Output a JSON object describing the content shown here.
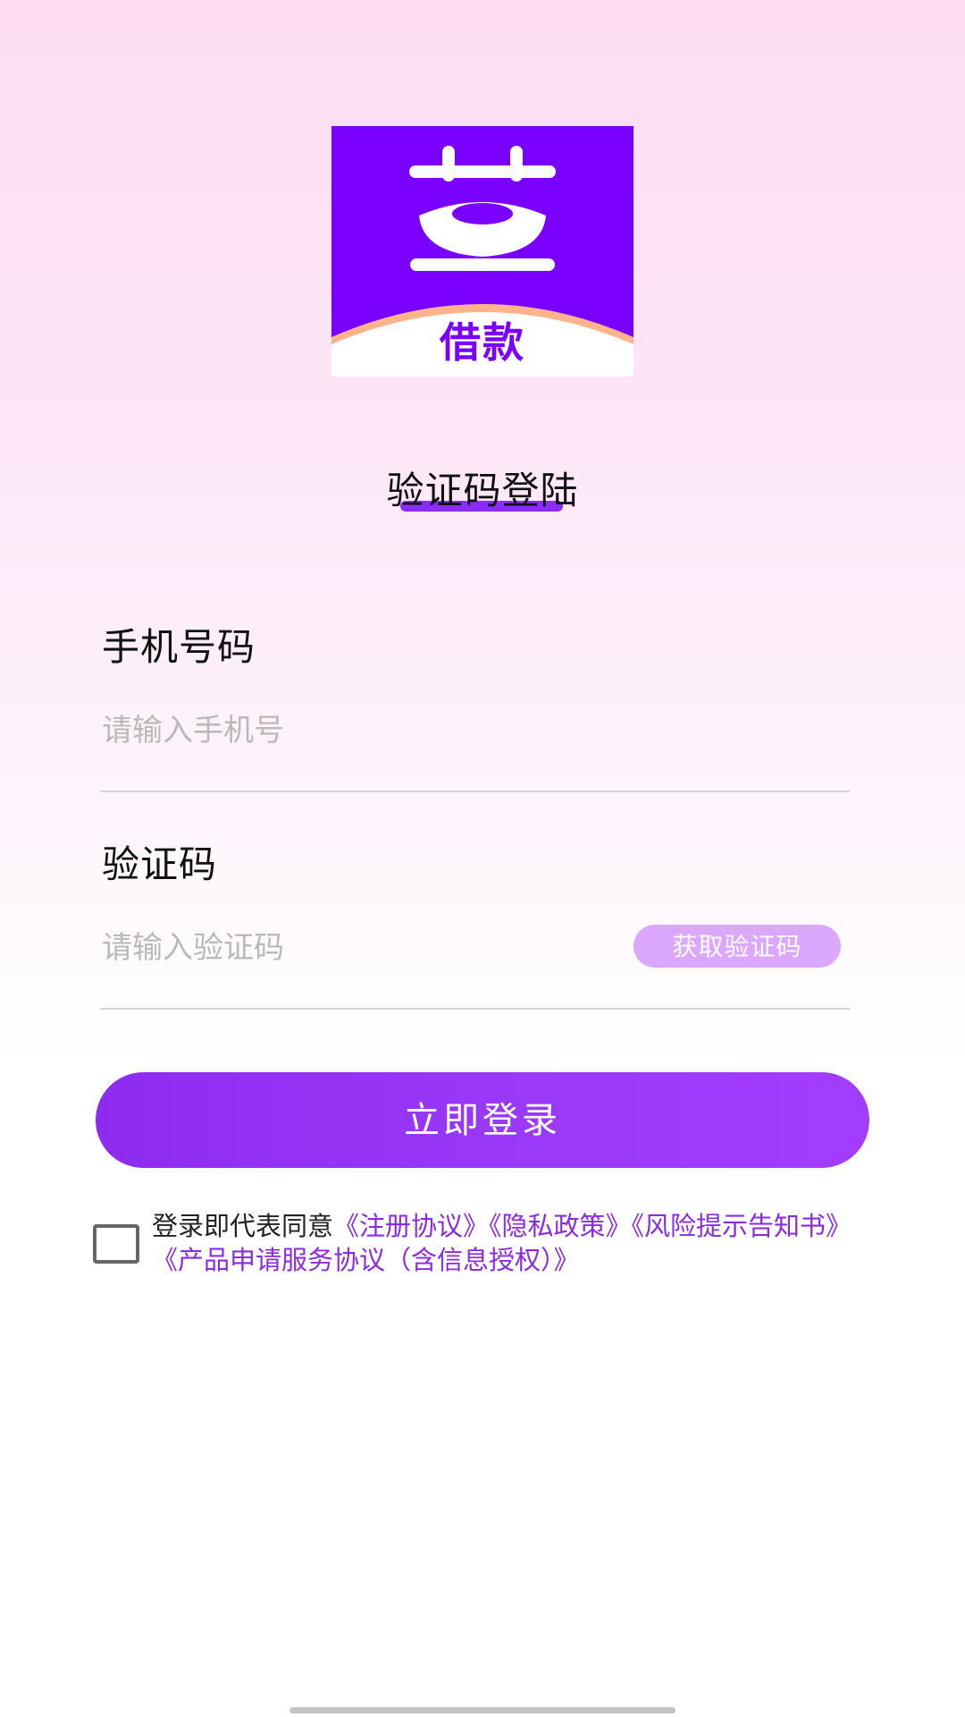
{
  "logo": {
    "text": "借款",
    "bg_color": "#7a00ff",
    "accent_color": "#ffb38a"
  },
  "page": {
    "title": "验证码登陆"
  },
  "form": {
    "phone_label": "手机号码",
    "phone_placeholder": "请输入手机号",
    "code_label": "验证码",
    "code_placeholder": "请输入验证码",
    "get_code_label": "获取验证码",
    "login_label": "立即登录"
  },
  "agreement": {
    "prefix": "登录即代表同意",
    "links": [
      "《注册协议》",
      "《隐私政策》",
      "《风险提示告知书》",
      "《产品申请服务协议（含信息授权）》"
    ],
    "checked": false
  },
  "colors": {
    "primary": "#9b3af9",
    "link": "#8a2be2",
    "get_code_bg": "#dca8ff"
  }
}
